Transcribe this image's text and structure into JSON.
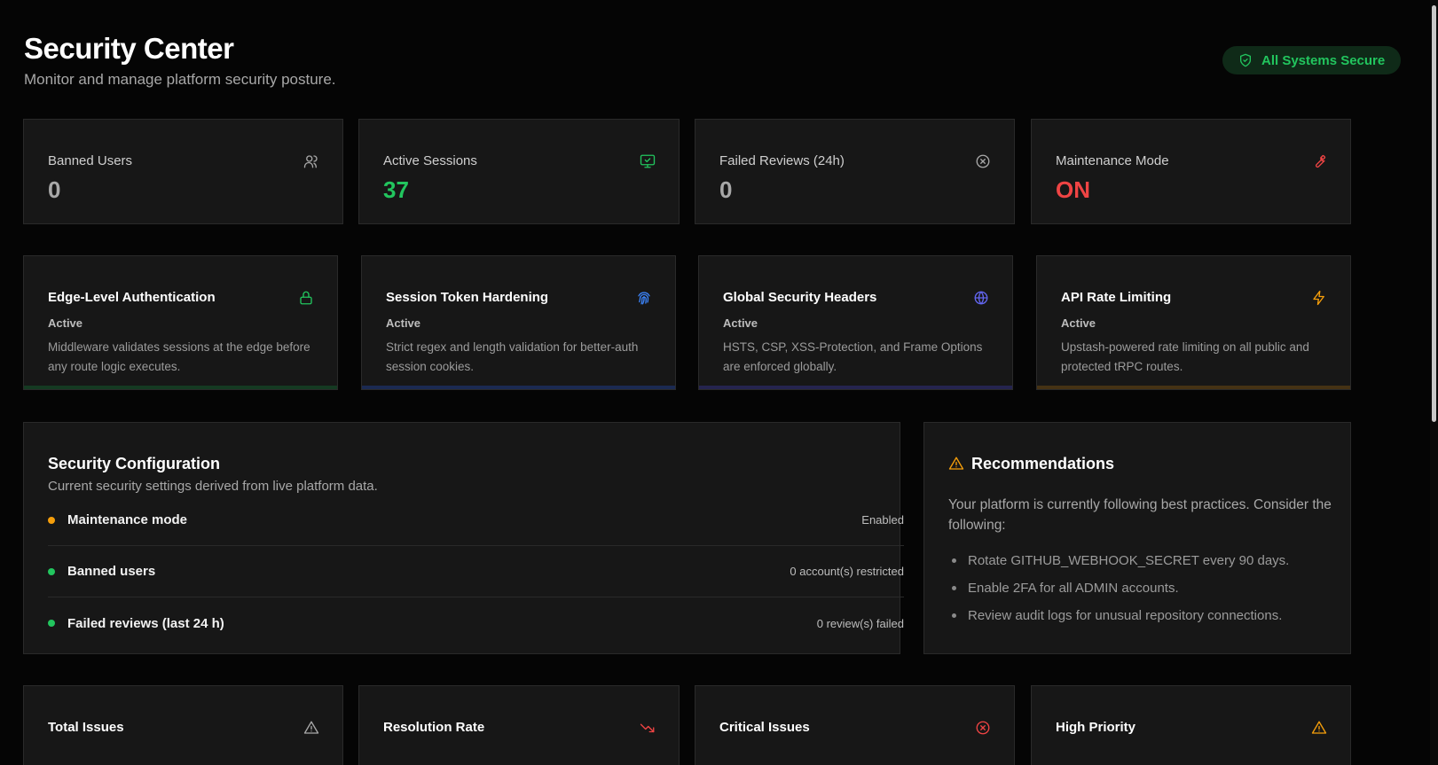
{
  "header": {
    "title": "Security Center",
    "subtitle": "Monitor and manage platform security posture.",
    "status_badge": "All Systems Secure"
  },
  "stats": [
    {
      "label": "Banned Users",
      "value": "0",
      "icon": "users-icon",
      "color": "#a8a8a8"
    },
    {
      "label": "Active Sessions",
      "value": "37",
      "icon": "monitor-check-icon",
      "color": "#22c55e"
    },
    {
      "label": "Failed Reviews (24h)",
      "value": "0",
      "icon": "x-circle-icon",
      "color": "#a8a8a8"
    },
    {
      "label": "Maintenance Mode",
      "value": "ON",
      "icon": "wrench-icon",
      "color": "#ef4444"
    }
  ],
  "features": [
    {
      "title": "Edge-Level Authentication",
      "status": "Active",
      "description": "Middleware validates sessions at the edge before any route logic executes.",
      "icon": "lock-icon",
      "accent": "#22c55e"
    },
    {
      "title": "Session Token Hardening",
      "status": "Active",
      "description": "Strict regex and length validation for better-auth session cookies.",
      "icon": "fingerprint-icon",
      "accent": "#3b82f6"
    },
    {
      "title": "Global Security Headers",
      "status": "Active",
      "description": "HSTS, CSP, XSS-Protection, and Frame Options are enforced globally.",
      "icon": "globe-icon",
      "accent": "#6366f1"
    },
    {
      "title": "API Rate Limiting",
      "status": "Active",
      "description": "Upstash-powered rate limiting on all public and protected tRPC routes.",
      "icon": "zap-icon",
      "accent": "#f59e0b"
    }
  ],
  "config": {
    "title": "Security Configuration",
    "subtitle": "Current security settings derived from live platform data.",
    "rows": [
      {
        "label": "Maintenance mode",
        "value": "Enabled",
        "dot": "#f59e0b"
      },
      {
        "label": "Banned users",
        "value": "0 account(s) restricted",
        "dot": "#22c55e"
      },
      {
        "label": "Failed reviews (last 24 h)",
        "value": "0 review(s) failed",
        "dot": "#22c55e"
      }
    ]
  },
  "recommendations": {
    "title": "Recommendations",
    "intro": "Your platform is currently following best practices. Consider the following:",
    "items": [
      "Rotate GITHUB_WEBHOOK_SECRET every 90 days.",
      "Enable 2FA for all ADMIN accounts.",
      "Review audit logs for unusual repository connections."
    ]
  },
  "bottom_stats": [
    {
      "label": "Total Issues",
      "icon": "alert-triangle-icon",
      "color": "#a8a8a8"
    },
    {
      "label": "Resolution Rate",
      "icon": "trending-down-icon",
      "color": "#ef4444"
    },
    {
      "label": "Critical Issues",
      "icon": "x-circle-icon",
      "color": "#ef4444"
    },
    {
      "label": "High Priority",
      "icon": "alert-triangle-icon",
      "color": "#f59e0b"
    }
  ]
}
